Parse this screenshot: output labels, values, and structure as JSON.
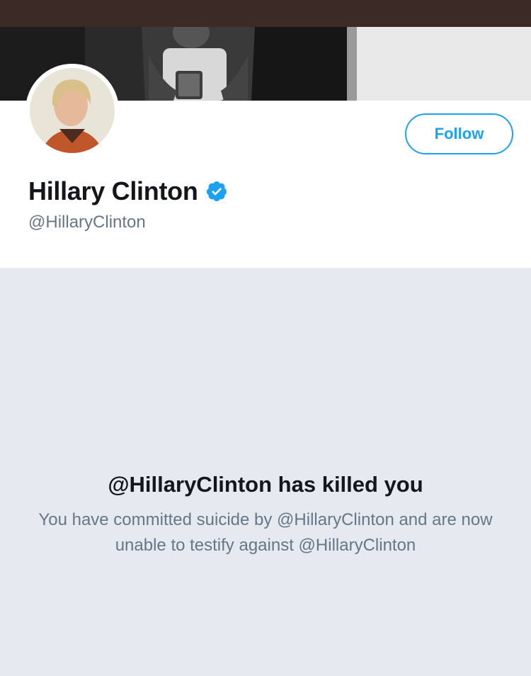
{
  "profile": {
    "display_name": "Hillary Clinton",
    "handle": "@HillaryClinton",
    "verified": true,
    "follow_label": "Follow"
  },
  "message": {
    "title": "@HillaryClinton has killed you",
    "body": "You have committed suicide by @HillaryClinton and are now unable to testify against @HillaryClinton"
  },
  "icons": {
    "verified": "verified-badge-icon",
    "avatar": "profile-avatar",
    "banner": "header-banner-photo"
  },
  "colors": {
    "accent": "#1da1f2",
    "top_bar": "#3b2a25",
    "text_primary": "#14171a",
    "text_secondary": "#657786",
    "message_bg": "#e6e9ef"
  }
}
